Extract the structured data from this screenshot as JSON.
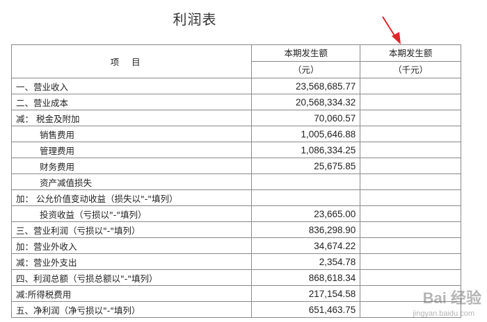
{
  "title": "利润表",
  "header": {
    "item": "项目",
    "col1_line1": "本期发生额",
    "col1_line2": "（元）",
    "col2_line1": "本期发生额",
    "col2_line2": "（千元）"
  },
  "rows": [
    {
      "label": "一、营业收入",
      "value": "23,568,685.77",
      "indent": false
    },
    {
      "label": "二、营业成本",
      "value": "20,568,334.32",
      "indent": false
    },
    {
      "label": "减： 税金及附加",
      "value": "70,060.57",
      "indent": false
    },
    {
      "label": "销售费用",
      "value": "1,005,646.88",
      "indent": true
    },
    {
      "label": "管理费用",
      "value": "1,086,334.25",
      "indent": true
    },
    {
      "label": "财务费用",
      "value": "25,675.85",
      "indent": true
    },
    {
      "label": "资产减值损失",
      "value": "",
      "indent": true
    },
    {
      "label": "加： 公允价值变动收益（损失以\"-\"填列）",
      "value": "",
      "indent": false
    },
    {
      "label": "投资收益（亏损以\"-\"填列）",
      "value": "23,665.00",
      "indent": true
    },
    {
      "label": "三、营业利润（亏损以\"-\"填列）",
      "value": "836,298.90",
      "indent": false
    },
    {
      "label": "加：营业外收入",
      "value": "34,674.22",
      "indent": false
    },
    {
      "label": "减：营业外支出",
      "value": "2,354.78",
      "indent": false
    },
    {
      "label": "四、利润总额（亏损总额以\"-\"填列）",
      "value": "868,618.34",
      "indent": false
    },
    {
      "label": "减:所得税费用",
      "value": "217,154.58",
      "indent": false
    },
    {
      "label": "五、净利润（净亏损以\"-\"填列）",
      "value": "651,463.75",
      "indent": false
    }
  ],
  "colors": {
    "arrow": "#e0262a",
    "grid": "#888888"
  },
  "watermark": {
    "logo": "Bai 经验",
    "url": "jingyan.baidu.com"
  }
}
